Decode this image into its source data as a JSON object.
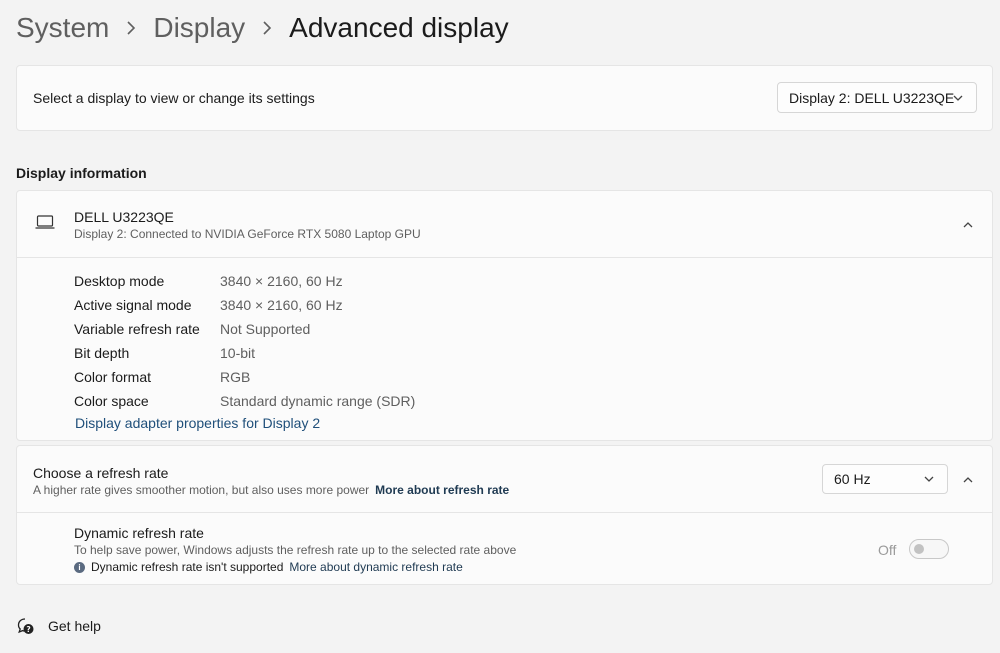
{
  "breadcrumb": {
    "items": [
      "System",
      "Display"
    ],
    "current": "Advanced display"
  },
  "display_select": {
    "label": "Select a display to view or change its settings",
    "selected": "Display 2: DELL U3223QE"
  },
  "display_info": {
    "section_title": "Display information",
    "monitor_name": "DELL U3223QE",
    "monitor_subtitle": "Display 2: Connected to NVIDIA GeForce RTX 5080 Laptop GPU",
    "properties": [
      {
        "key": "Desktop mode",
        "value": "3840 × 2160, 60 Hz"
      },
      {
        "key": "Active signal mode",
        "value": "3840 × 2160, 60 Hz"
      },
      {
        "key": "Variable refresh rate",
        "value": "Not Supported"
      },
      {
        "key": "Bit depth",
        "value": "10-bit"
      },
      {
        "key": "Color format",
        "value": "RGB"
      },
      {
        "key": "Color space",
        "value": "Standard dynamic range (SDR)"
      }
    ],
    "adapter_link": "Display adapter properties for Display 2"
  },
  "refresh_rate": {
    "title": "Choose a refresh rate",
    "subtitle": "A higher rate gives smoother motion, but also uses more power",
    "link": "More about refresh rate",
    "selected": "60 Hz"
  },
  "dynamic_refresh": {
    "title": "Dynamic refresh rate",
    "subtitle": "To help save power, Windows adjusts the refresh rate up to the selected rate above",
    "note": "Dynamic refresh rate isn't supported",
    "note_link": "More about dynamic refresh rate",
    "toggle_label": "Off",
    "toggle_on": false
  },
  "help": {
    "label": "Get help"
  },
  "icons": {
    "breadcrumb_separator": "chevron-right-icon",
    "monitor": "laptop-icon",
    "collapse": "chevron-up-icon",
    "dropdown": "chevron-down-icon",
    "info": "info-icon",
    "help": "help-icon"
  },
  "colors": {
    "background": "#f3f3f3",
    "card": "#fbfbfb",
    "link": "#1f4f7a"
  }
}
